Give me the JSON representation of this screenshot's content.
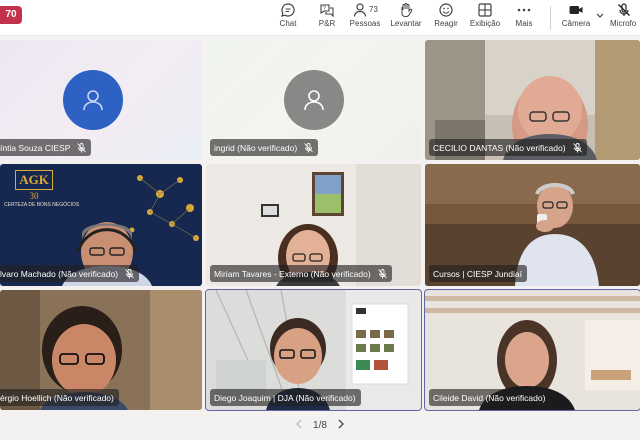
{
  "notification": {
    "count": "70"
  },
  "toolbar": {
    "chat": "Chat",
    "qa": "P&R",
    "people_count": "73",
    "people": "Pessoas",
    "raise": "Levantar",
    "react": "Reagir",
    "view": "Exibição",
    "more": "Mais",
    "camera": "Câmera",
    "mic": "Microfo"
  },
  "participants": [
    {
      "name": "íntia Souza CIESP"
    },
    {
      "name": "ingrid (Não verificado)"
    },
    {
      "name": "CECILIO DANTAS (Não verificado)"
    },
    {
      "name": "lvaro Machado (Não verificado)"
    },
    {
      "name": "Miriam Tavares - Externo (Não verificado)"
    },
    {
      "name": "Cursos | CIESP Jundiaí"
    },
    {
      "name": "érgio Hoellich (Não verificado)"
    },
    {
      "name": "Diego Joaquim | DJA (Não verificado)"
    },
    {
      "name": "Cileide David (Não verificado)"
    }
  ],
  "logo": {
    "letters": "AGK",
    "years": "30",
    "tagline": "CERTEZA DE BONS NEGÓCIOS"
  },
  "pager": {
    "label": "1/8"
  },
  "colors": {
    "accent": "#6264a7",
    "badge": "#c4314b",
    "avatar_blue": "#2d61c4",
    "avatar_grey": "#8a8886"
  }
}
